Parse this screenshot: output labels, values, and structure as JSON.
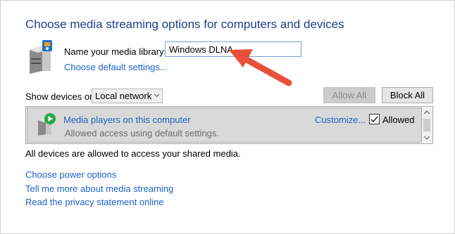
{
  "header": {
    "title": "Choose media streaming options for computers and devices"
  },
  "library": {
    "label": "Name your media library:",
    "value": "Windows DLNA",
    "default_settings_link": "Choose default settings..."
  },
  "devices": {
    "show_label": "Show devices on:",
    "network_selected": "Local network",
    "allow_all_label": "Allow All",
    "block_all_label": "Block All",
    "list": [
      {
        "name": "Media players on this computer",
        "status": "Allowed access using default settings.",
        "customize_label": "Customize...",
        "allowed_label": "Allowed",
        "allowed_checked": true
      }
    ]
  },
  "info_text": "All devices are allowed to access your shared media.",
  "links": {
    "power": "Choose power options",
    "tell_more": "Tell me more about media streaming",
    "privacy": "Read the privacy statement online"
  },
  "icons": {
    "server": "media-server-icon",
    "device": "media-player-device-icon",
    "dropdown": "chevron-down-icon",
    "annotation": "red-arrow-icon"
  },
  "colors": {
    "title": "#1e3e8c",
    "link": "#1a63c7",
    "row_background": "#d9d9d9",
    "annotation_arrow": "#e8503a"
  }
}
